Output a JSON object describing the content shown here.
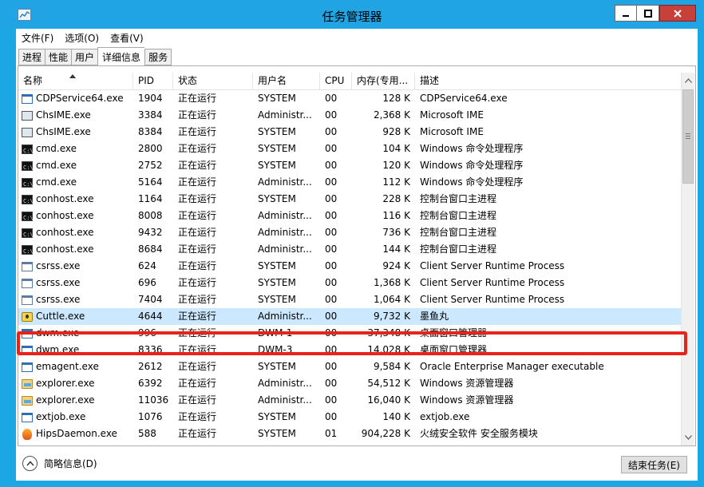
{
  "window": {
    "title": "任务管理器",
    "minimize_glyph": "—",
    "close_glyph": "✕"
  },
  "menu": [
    "文件(F)",
    "选项(O)",
    "查看(V)"
  ],
  "tabs": [
    {
      "label": "进程",
      "active": false
    },
    {
      "label": "性能",
      "active": false
    },
    {
      "label": "用户",
      "active": false
    },
    {
      "label": "详细信息",
      "active": true
    },
    {
      "label": "服务",
      "active": false
    }
  ],
  "columns": [
    "名称",
    "PID",
    "状态",
    "用户名",
    "CPU",
    "内存(专用...",
    "描述"
  ],
  "sort_column": "名称",
  "processes": [
    {
      "name": "CDPService64.exe",
      "pid": "1904",
      "status": "正在运行",
      "user": "SYSTEM",
      "cpu": "00",
      "mem": "128 K",
      "desc": "CDPService64.exe",
      "icon": "window-icon"
    },
    {
      "name": "ChsIME.exe",
      "pid": "3384",
      "status": "正在运行",
      "user": "Administr...",
      "cpu": "00",
      "mem": "2,368 K",
      "desc": "Microsoft IME",
      "icon": "ime-icon"
    },
    {
      "name": "ChsIME.exe",
      "pid": "8384",
      "status": "正在运行",
      "user": "SYSTEM",
      "cpu": "00",
      "mem": "928 K",
      "desc": "Microsoft IME",
      "icon": "ime-icon"
    },
    {
      "name": "cmd.exe",
      "pid": "2800",
      "status": "正在运行",
      "user": "SYSTEM",
      "cpu": "00",
      "mem": "104 K",
      "desc": "Windows 命令处理程序",
      "icon": "cmd-icon"
    },
    {
      "name": "cmd.exe",
      "pid": "2752",
      "status": "正在运行",
      "user": "SYSTEM",
      "cpu": "00",
      "mem": "120 K",
      "desc": "Windows 命令处理程序",
      "icon": "cmd-icon"
    },
    {
      "name": "cmd.exe",
      "pid": "5164",
      "status": "正在运行",
      "user": "Administr...",
      "cpu": "00",
      "mem": "112 K",
      "desc": "Windows 命令处理程序",
      "icon": "cmd-icon"
    },
    {
      "name": "conhost.exe",
      "pid": "1164",
      "status": "正在运行",
      "user": "SYSTEM",
      "cpu": "00",
      "mem": "228 K",
      "desc": "控制台窗口主进程",
      "icon": "cmd-icon"
    },
    {
      "name": "conhost.exe",
      "pid": "8008",
      "status": "正在运行",
      "user": "Administr...",
      "cpu": "00",
      "mem": "116 K",
      "desc": "控制台窗口主进程",
      "icon": "cmd-icon"
    },
    {
      "name": "conhost.exe",
      "pid": "9432",
      "status": "正在运行",
      "user": "Administr...",
      "cpu": "00",
      "mem": "736 K",
      "desc": "控制台窗口主进程",
      "icon": "cmd-icon"
    },
    {
      "name": "conhost.exe",
      "pid": "8684",
      "status": "正在运行",
      "user": "Administr...",
      "cpu": "00",
      "mem": "144 K",
      "desc": "控制台窗口主进程",
      "icon": "cmd-icon"
    },
    {
      "name": "csrss.exe",
      "pid": "624",
      "status": "正在运行",
      "user": "SYSTEM",
      "cpu": "00",
      "mem": "924 K",
      "desc": "Client Server Runtime Process",
      "icon": "csrss-icon"
    },
    {
      "name": "csrss.exe",
      "pid": "696",
      "status": "正在运行",
      "user": "SYSTEM",
      "cpu": "00",
      "mem": "1,368 K",
      "desc": "Client Server Runtime Process",
      "icon": "csrss-icon"
    },
    {
      "name": "csrss.exe",
      "pid": "7404",
      "status": "正在运行",
      "user": "SYSTEM",
      "cpu": "00",
      "mem": "1,064 K",
      "desc": "Client Server Runtime Process",
      "icon": "csrss-icon"
    },
    {
      "name": "Cuttle.exe",
      "pid": "4644",
      "status": "正在运行",
      "user": "Administr...",
      "cpu": "00",
      "mem": "9,732 K",
      "desc": "墨鱼丸",
      "icon": "cuttle-icon",
      "selected": true
    },
    {
      "name": "dwm.exe",
      "pid": "996",
      "status": "正在运行",
      "user": "DWM-1",
      "cpu": "00",
      "mem": "37,348 K",
      "desc": "桌面窗口管理器",
      "icon": "window-icon"
    },
    {
      "name": "dwm.exe",
      "pid": "8336",
      "status": "正在运行",
      "user": "DWM-3",
      "cpu": "00",
      "mem": "14,028 K",
      "desc": "桌面窗口管理器",
      "icon": "window-icon"
    },
    {
      "name": "emagent.exe",
      "pid": "2612",
      "status": "正在运行",
      "user": "SYSTEM",
      "cpu": "00",
      "mem": "9,584 K",
      "desc": "Oracle Enterprise Manager executable",
      "icon": "window-icon"
    },
    {
      "name": "explorer.exe",
      "pid": "6392",
      "status": "正在运行",
      "user": "Administr...",
      "cpu": "00",
      "mem": "54,512 K",
      "desc": "Windows 资源管理器",
      "icon": "folder-icon"
    },
    {
      "name": "explorer.exe",
      "pid": "11036",
      "status": "正在运行",
      "user": "Administr...",
      "cpu": "00",
      "mem": "16,040 K",
      "desc": "Windows 资源管理器",
      "icon": "folder-icon"
    },
    {
      "name": "extjob.exe",
      "pid": "1076",
      "status": "正在运行",
      "user": "SYSTEM",
      "cpu": "00",
      "mem": "140 K",
      "desc": "extjob.exe",
      "icon": "window-icon"
    },
    {
      "name": "HipsDaemon.exe",
      "pid": "588",
      "status": "正在运行",
      "user": "SYSTEM",
      "cpu": "01",
      "mem": "904,228 K",
      "desc": "火绒安全软件 安全服务模块",
      "icon": "hips-icon"
    }
  ],
  "footer": {
    "fewer_details": "简略信息(D)",
    "end_task": "结束任务(E)"
  },
  "colors": {
    "title_bar": "#20a4e3",
    "selection": "#cce8ff",
    "highlight_border": "#e8231a",
    "close_button": "#c7403a"
  }
}
